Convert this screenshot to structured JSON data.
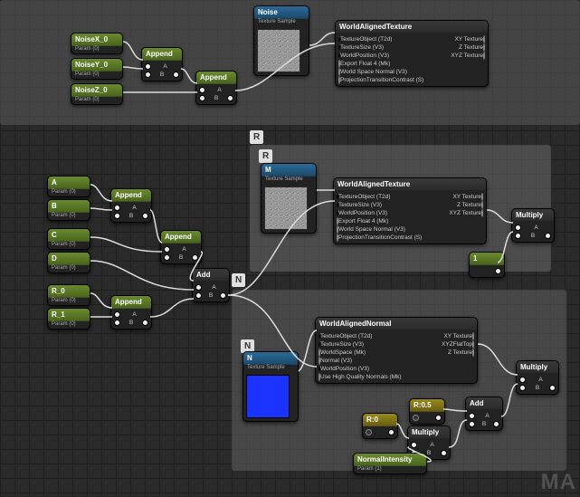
{
  "watermark": "MA",
  "regions": {
    "top": {
      "label": ""
    },
    "mid": {
      "label": "R"
    },
    "mid_inner": {
      "label": "R"
    },
    "bot": {
      "label": "N"
    },
    "bot_inner": {
      "label": "N"
    }
  },
  "params": {
    "noise": [
      {
        "name": "NoiseX_0",
        "sub": "Param (0)"
      },
      {
        "name": "NoiseY_0",
        "sub": "Param (0)"
      },
      {
        "name": "NoiseZ_0",
        "sub": "Param (0)"
      }
    ],
    "mid_left_top": [
      {
        "name": "A",
        "sub": "Param (0)"
      },
      {
        "name": "B",
        "sub": "Param (0)"
      }
    ],
    "mid_left_mid": [
      {
        "name": "C",
        "sub": "Param (0)"
      },
      {
        "name": "D",
        "sub": "Param (0)"
      }
    ],
    "mid_left_bot": [
      {
        "name": "R_0",
        "sub": "Param (0)"
      },
      {
        "name": "R_1",
        "sub": "Param (0)"
      }
    ]
  },
  "appends": {
    "a1": {
      "title": "Append",
      "a": "A",
      "b": "B"
    },
    "a2": {
      "title": "Append",
      "a": "A",
      "b": "B"
    },
    "a3": {
      "title": "Append",
      "a": "A",
      "b": "B"
    },
    "a4": {
      "title": "Append",
      "a": "A",
      "b": "B"
    },
    "a5": {
      "title": "Append",
      "a": "A",
      "b": "B"
    }
  },
  "add": {
    "title": "Add",
    "a": "A",
    "b": "B"
  },
  "add2": {
    "title": "Add",
    "a": "A",
    "b": "B"
  },
  "multiply1": {
    "title": "Multiply",
    "a": "A",
    "b": "B"
  },
  "multiply2": {
    "title": "Multiply",
    "a": "A",
    "b": "B"
  },
  "multiply3": {
    "title": "Multiply",
    "a": "A",
    "b": "B"
  },
  "const_green": {
    "title": "1",
    "sub": ""
  },
  "rotR": {
    "title": "R:0"
  },
  "rotY": {
    "title": "R:0.5"
  },
  "normalIntensity": {
    "title": "NormalIntensity",
    "sub": "Param (1)"
  },
  "textures": {
    "noise": {
      "title": "Noise",
      "sub": "Texture Sample"
    },
    "mid": {
      "title": "M",
      "sub": "Texture Sample"
    },
    "normal": {
      "title": "N",
      "sub": "Texture Sample"
    }
  },
  "func_nodes": {
    "wat1": {
      "title": "WorldAlignedTexture",
      "inputs": [
        "TextureObject (T2d)",
        "TextureSize (V3)",
        "WorldPosition (V3)",
        "Export Float 4 (Mk)",
        "World Space Normal (V3)",
        "ProjectionTransitionContrast (S)"
      ],
      "outputs": [
        "XY Texture",
        "Z Texture",
        "XYZ Texture"
      ]
    },
    "wat2": {
      "title": "WorldAlignedTexture",
      "inputs": [
        "TextureObject (T2d)",
        "TextureSize (V3)",
        "WorldPosition (V3)",
        "Export Float 4 (Mk)",
        "World Space Normal (V3)",
        "ProjectionTransitionContrast (S)"
      ],
      "outputs": [
        "XY Texture",
        "Z Texture",
        "XYZ Texture"
      ]
    },
    "wan": {
      "title": "WorldAlignedNormal",
      "inputs": [
        "TextureObject (T2d)",
        "TextureSize (V3)",
        "WorldSpace (Mk)",
        "Normal (V3)",
        "WorldPosition (V3)",
        "Use High Quality Normals (Mk)"
      ],
      "outputs": [
        "XY Texture",
        "XYZFlatTop",
        "Z Texture"
      ]
    }
  }
}
